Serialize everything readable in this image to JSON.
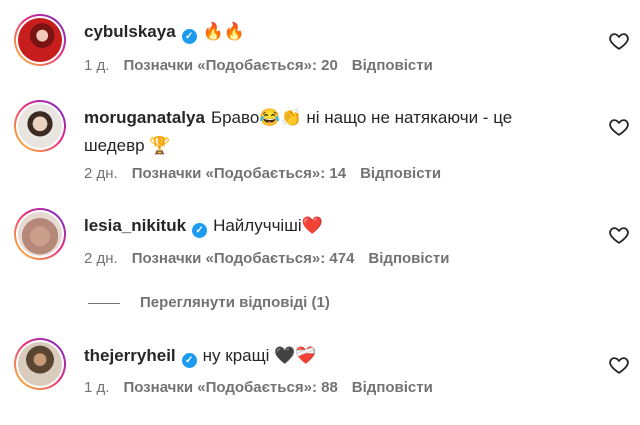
{
  "comments": [
    {
      "username": "cybulskaya",
      "verified": true,
      "text": "🔥🔥",
      "time": "1 д.",
      "likes": "Позначки «Подобається»: 20",
      "reply": "Відповісти"
    },
    {
      "username": "moruganatalya",
      "verified": false,
      "text": "Браво😂👏 ні нащо не натякаючи - це шедевр 🏆",
      "time": "2 дн.",
      "likes": "Позначки «Подобається»: 14",
      "reply": "Відповісти"
    },
    {
      "username": "lesia_nikituk",
      "verified": true,
      "text": "Найлуччіші❤️",
      "time": "2 дн.",
      "likes": "Позначки «Подобається»: 474",
      "reply": "Відповісти"
    },
    {
      "username": "thejerryheil",
      "verified": true,
      "text": "ну кращі 🖤❤️‍🩹",
      "time": "1 д.",
      "likes": "Позначки «Подобається»: 88",
      "reply": "Відповісти"
    }
  ],
  "view_replies": "Переглянути відповіді (1)",
  "icons": {
    "verified": "verified-badge-icon",
    "like": "heart-outline-icon"
  },
  "colors": {
    "verified": "#1d9bf0",
    "muted": "#737373",
    "text": "#262626"
  }
}
